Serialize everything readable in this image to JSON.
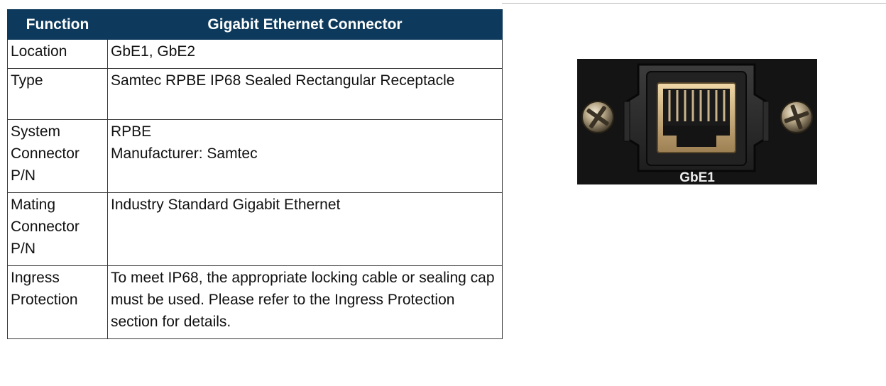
{
  "table": {
    "headers": {
      "function": "Function",
      "connector": "Gigabit Ethernet Connector"
    },
    "rows": {
      "location": {
        "label": "Location",
        "value": "GbE1, GbE2"
      },
      "type": {
        "label": "Type",
        "value": "Samtec RPBE IP68 Sealed Rectangular Receptacle"
      },
      "system": {
        "label": "System Connector P/N",
        "value": "RPBE\nManufacturer: Samtec"
      },
      "mating": {
        "label": "Mating Connector P/N",
        "value": "Industry Standard Gigabit Ethernet"
      },
      "ingress": {
        "label": "Ingress Protection",
        "value": "To meet IP68, the appropriate locking cable or sealing cap must be used. Please refer to the Ingress Protection section for details."
      }
    }
  },
  "photo": {
    "port_label": "GbE1"
  }
}
